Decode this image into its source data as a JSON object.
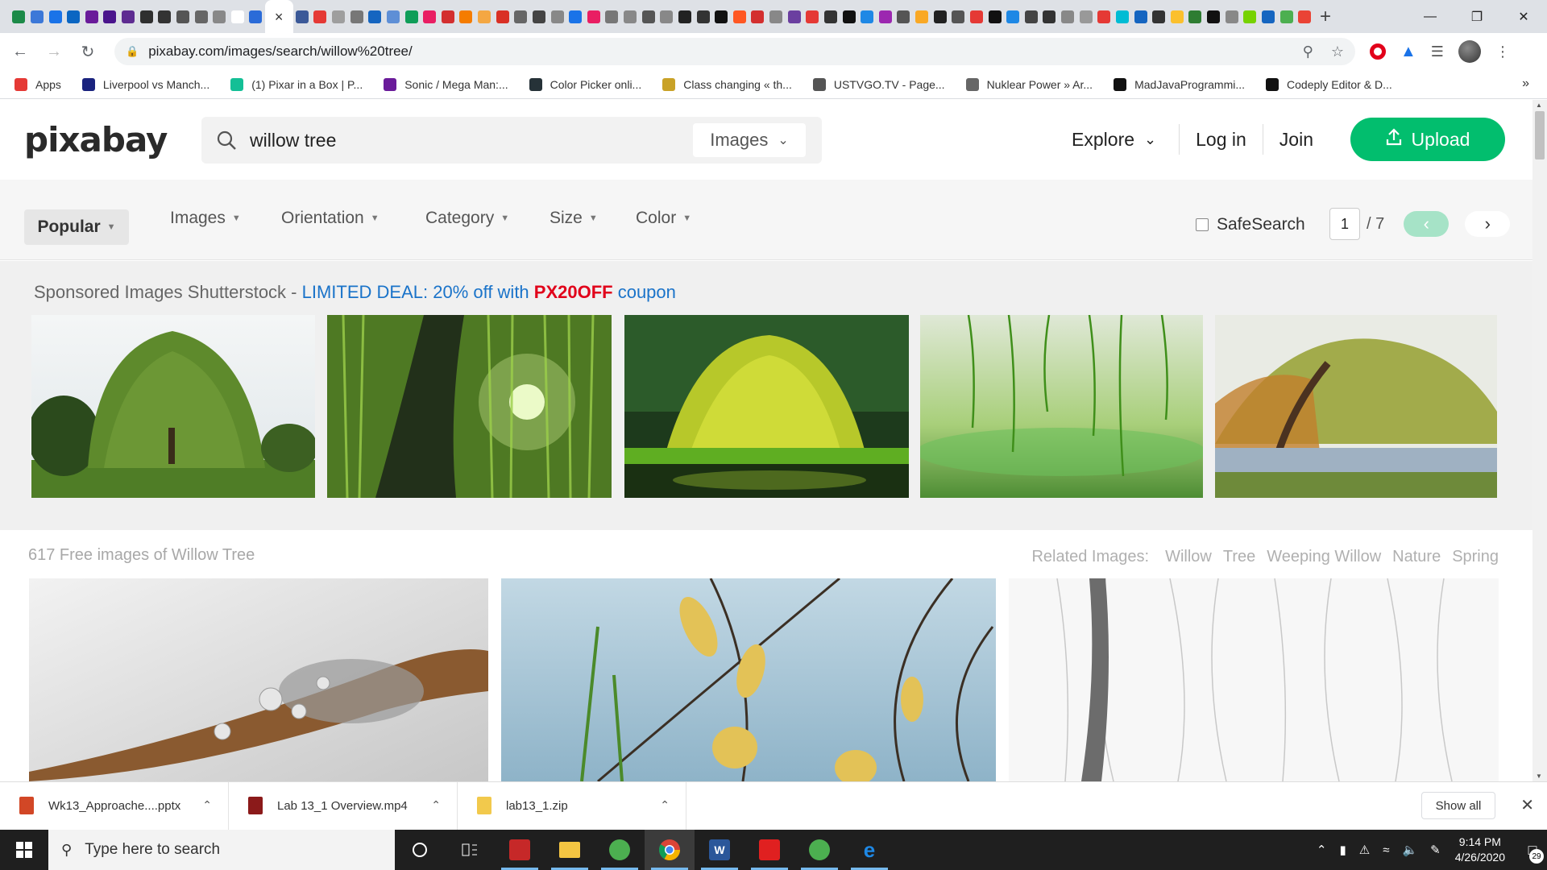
{
  "browser": {
    "url": "pixabay.com/images/search/willow%20tree/",
    "tab_colors": [
      "#1c8a48",
      "#3c78d8",
      "#1a73e8",
      "#0b66c2",
      "#6a1b9a",
      "#4a148c",
      "#5e2c91",
      "#2f2f2f",
      "#333",
      "#555",
      "#666",
      "#888",
      "#ffffff",
      "#2a6bd8",
      "#3b5998",
      "#e53935",
      "#9e9e9e",
      "#777",
      "#1565c0",
      "#5e8fd6",
      "#0f9d58",
      "#e91e63",
      "#d32f2f",
      "#f57c00",
      "#f4a742",
      "#d93025",
      "#666",
      "#444",
      "#888",
      "#1a73e8",
      "#e91e63",
      "#777",
      "#888",
      "#555",
      "#888",
      "#222",
      "#333",
      "#111",
      "#ff5722",
      "#d32f2f",
      "#888",
      "#6b3fa0",
      "#e53935",
      "#333",
      "#111",
      "#1e88e5",
      "#9c27b0",
      "#555",
      "#f9a825",
      "#212121",
      "#555",
      "#e53935",
      "#111",
      "#1e88e5",
      "#444",
      "#333",
      "#888",
      "#999",
      "#e53935",
      "#00bcd4",
      "#1565c0",
      "#333",
      "#fbc02d",
      "#2e7d32",
      "#111",
      "#888",
      "#76d200",
      "#1565c0",
      "#4caf50",
      "#ea4335"
    ],
    "active_tab_close": "×",
    "new_tab": "+",
    "window_controls": [
      "—",
      "❐",
      "✕"
    ],
    "bookmarks": [
      {
        "label": "Apps",
        "color": "#e53935"
      },
      {
        "label": "Liverpool vs Manch...",
        "color": "#1a237e"
      },
      {
        "label": "(1) Pixar in a Box | P...",
        "color": "#14bf96"
      },
      {
        "label": "Sonic / Mega Man:...",
        "color": "#6a1b9a"
      },
      {
        "label": "Color Picker onli...",
        "color": "#263238"
      },
      {
        "label": "Class changing « th...",
        "color": "#c9a227"
      },
      {
        "label": "USTVGO.TV - Page...",
        "color": "#555555"
      },
      {
        "label": "Nuklear Power » Ar...",
        "color": "#666666"
      },
      {
        "label": "MadJavaProgrammi...",
        "color": "#111111"
      },
      {
        "label": "Codeply Editor & D...",
        "color": "#111111"
      }
    ],
    "bookmarks_more": "»"
  },
  "header": {
    "logo": "pixabay",
    "search_value": "willow tree",
    "search_type": "Images",
    "explore": "Explore",
    "login": "Log in",
    "join": "Join",
    "upload": "Upload"
  },
  "filters": {
    "popular": "Popular",
    "items": [
      "Images",
      "Orientation",
      "Category",
      "Size",
      "Color"
    ],
    "safesearch": "SafeSearch",
    "page_current": "1",
    "page_total": "/ 7"
  },
  "sponsored": {
    "prefix": "Sponsored Images Shutterstock - ",
    "deal": "LIMITED DEAL: 20% off with ",
    "code": "PX20OFF",
    "suffix": " coupon"
  },
  "results": {
    "count_text": "617 Free images of Willow Tree",
    "related_label": "Related Images:",
    "related": [
      "Willow",
      "Tree",
      "Weeping Willow",
      "Nature",
      "Spring"
    ]
  },
  "downloads": [
    {
      "name": "Wk13_Approache....pptx",
      "color": "#d24726"
    },
    {
      "name": "Lab 13_1 Overview.mp4",
      "color": "#8b1a1a"
    },
    {
      "name": "lab13_1.zip",
      "color": "#f2c94c"
    }
  ],
  "downloads_show_all": "Show all",
  "taskbar": {
    "search_placeholder": "Type here to search",
    "time": "9:14 PM",
    "date": "4/26/2020",
    "notifications": "29"
  }
}
